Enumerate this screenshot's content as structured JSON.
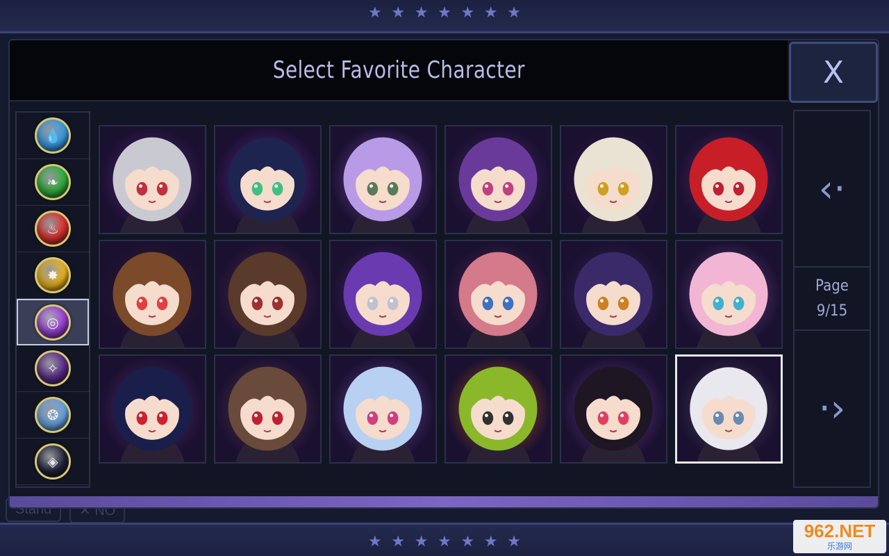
{
  "window": {
    "title": "Select Favorite Character",
    "close_label": "X"
  },
  "background": {
    "left_button_label": "Stand",
    "right_button_label": "✕ NO"
  },
  "elements": [
    {
      "name": "water",
      "color": "#3a9ee8",
      "glyph": "💧",
      "selected": false
    },
    {
      "name": "nature",
      "color": "#2fb33a",
      "glyph": "❧",
      "selected": false
    },
    {
      "name": "fire",
      "color": "#e0302a",
      "glyph": "♨",
      "selected": false
    },
    {
      "name": "light",
      "color": "#f0b81c",
      "glyph": "✸",
      "selected": false
    },
    {
      "name": "wind",
      "color": "#9a3ed8",
      "glyph": "◎",
      "selected": true
    },
    {
      "name": "dark",
      "color": "#5a2a8a",
      "glyph": "✧",
      "selected": false
    },
    {
      "name": "ice",
      "color": "#6aa8e8",
      "glyph": "❂",
      "selected": false
    },
    {
      "name": "void",
      "color": "#1e2038",
      "glyph": "◈",
      "selected": false
    }
  ],
  "characters": [
    {
      "hair": "#c9c9d2",
      "bg": "#5a2a7a",
      "eyes": "#c03040",
      "selected": false
    },
    {
      "hair": "#1e2450",
      "bg": "#6a2a9a",
      "eyes": "#40c080",
      "selected": false
    },
    {
      "hair": "#b89ae6",
      "bg": "#7a4ab0",
      "eyes": "#5a7a5a",
      "selected": false
    },
    {
      "hair": "#6a3a9a",
      "bg": "#4a2a6a",
      "eyes": "#c04080",
      "selected": false
    },
    {
      "hair": "#eae2d2",
      "bg": "#3a1a4a",
      "eyes": "#d0a020",
      "selected": false
    },
    {
      "hair": "#c81e28",
      "bg": "#5a2a6a",
      "eyes": "#c02030",
      "selected": false
    },
    {
      "hair": "#7a4a2a",
      "bg": "#3a1e2a",
      "eyes": "#e04040",
      "selected": false
    },
    {
      "hair": "#5a3a2a",
      "bg": "#5a2a4a",
      "eyes": "#a03030",
      "selected": false
    },
    {
      "hair": "#6a3ab0",
      "bg": "#4a2a6a",
      "eyes": "#c0c0d0",
      "selected": false
    },
    {
      "hair": "#d47a8a",
      "bg": "#5a2a5a",
      "eyes": "#4070c0",
      "selected": false
    },
    {
      "hair": "#3a2a6a",
      "bg": "#3a2a5a",
      "eyes": "#d08020",
      "selected": false
    },
    {
      "hair": "#f2b6d4",
      "bg": "#6a4a8a",
      "eyes": "#40b0d0",
      "selected": false
    },
    {
      "hair": "#1a1e4a",
      "bg": "#5a2a6a",
      "eyes": "#d02030",
      "selected": false
    },
    {
      "hair": "#6a4a3a",
      "bg": "#5a3a4a",
      "eyes": "#c02030",
      "selected": false
    },
    {
      "hair": "#b8d0f2",
      "bg": "#6a4aa0",
      "eyes": "#d04080",
      "selected": false
    },
    {
      "hair": "#8ab82a",
      "bg": "#b85a1a",
      "eyes": "#303030",
      "selected": false
    },
    {
      "hair": "#1e1622",
      "bg": "#6a3a9a",
      "eyes": "#e04060",
      "selected": false
    },
    {
      "hair": "#e8e8ee",
      "bg": "#4a4a5a",
      "eyes": "#6a8ab0",
      "selected": true
    }
  ],
  "pagination": {
    "label": "Page",
    "value": "9/15",
    "prev_glyph": "‹·",
    "next_glyph": "·›"
  },
  "watermark": {
    "main": "962.NET",
    "sub": "乐游网"
  },
  "accent_colors": {
    "title_text": "#b8bde8",
    "panel_border": "#2a3048",
    "bottom_bar": "#7b66c4"
  }
}
